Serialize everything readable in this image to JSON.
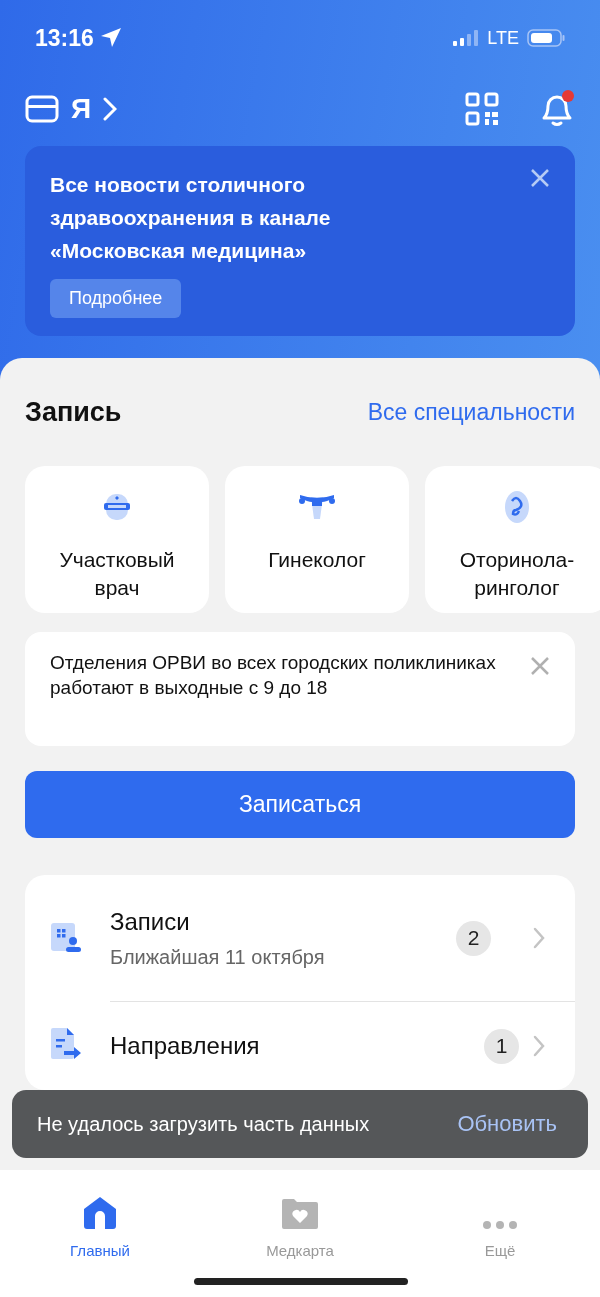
{
  "status_bar": {
    "time": "13:16",
    "network": "LTE"
  },
  "header": {
    "profile_letter": "Я"
  },
  "banner": {
    "title": "Все новости столичного здравоохранения в канале «Московская медицина»",
    "button": "Подробнее"
  },
  "booking": {
    "title": "Запись",
    "link": "Все специальности",
    "specialties": [
      {
        "kind": "doctor",
        "label": "Участковый врач"
      },
      {
        "kind": "gynecologist",
        "label": "Гинеколог"
      },
      {
        "kind": "ent",
        "label": "Оторинола-ринголог"
      }
    ],
    "notice": "Отделения ОРВИ во всех городских поликлиниках работают в выходные с 9 до 18",
    "button": "Записаться"
  },
  "list": [
    {
      "kind": "appointments",
      "title": "Записи",
      "subtitle": "Ближайшая 11 октября",
      "count": "2"
    },
    {
      "kind": "referrals",
      "title": "Направления",
      "count": "1"
    }
  ],
  "toast": {
    "message": "Не удалось загрузить часть данных",
    "action": "Обновить"
  },
  "tabs": [
    {
      "kind": "home",
      "label": "Главный",
      "selected": true
    },
    {
      "kind": "medcard",
      "label": "Медкарта",
      "selected": false
    },
    {
      "kind": "more",
      "label": "Ещё",
      "selected": false
    }
  ]
}
